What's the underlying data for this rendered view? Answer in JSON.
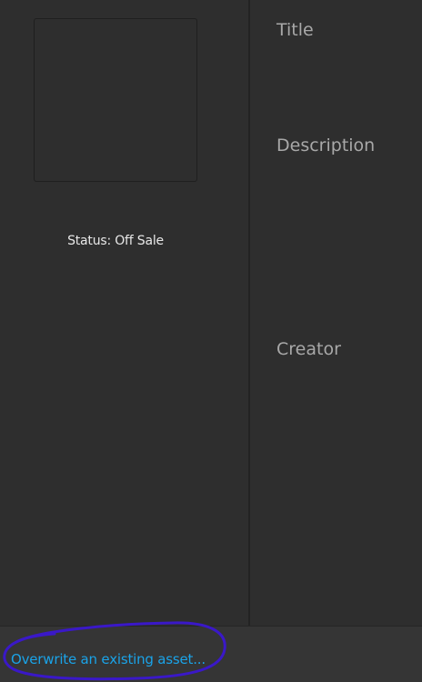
{
  "asset": {
    "status": "Status: Off Sale"
  },
  "fields": {
    "title_label": "Title",
    "description_label": "Description",
    "creator_label": "Creator"
  },
  "footer": {
    "overwrite_link": "Overwrite an existing asset..."
  },
  "colors": {
    "background": "#2e2e2e",
    "footer_background": "#353535",
    "link": "#1aa3e8",
    "annotation": "#3a18c8"
  }
}
